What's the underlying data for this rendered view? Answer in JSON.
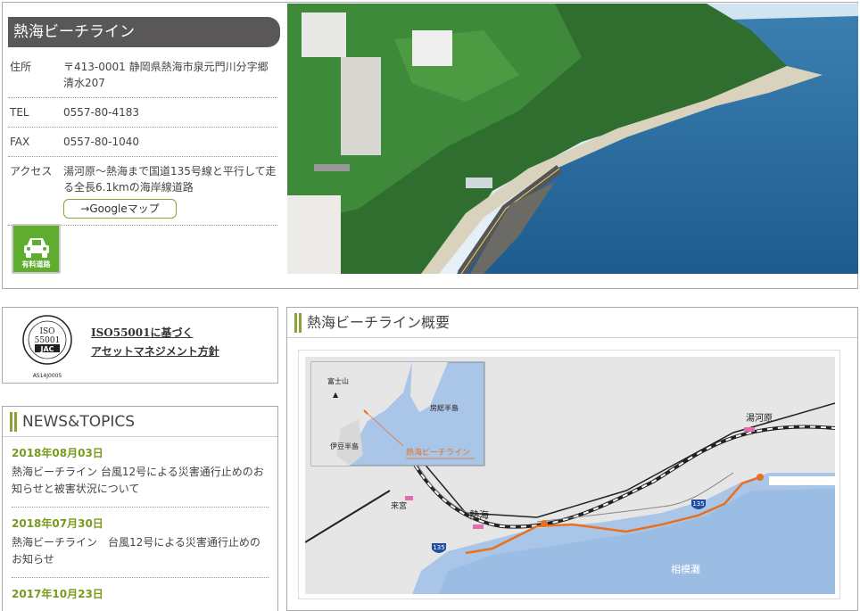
{
  "facility": {
    "title": "熱海ビーチライン",
    "rows": [
      {
        "label": "住所",
        "value": "〒413-0001 静岡県熱海市泉元門川分字郷清水207"
      },
      {
        "label": "TEL",
        "value": "0557-80-4183"
      },
      {
        "label": "FAX",
        "value": "0557-80-1040"
      },
      {
        "label": "アクセス",
        "value": "湯河原～熱海まで国道135号線と平行して走る全長6.1kmの海岸線道路"
      }
    ],
    "map_button": "→Googleマップ",
    "toll_badge": "有料道路"
  },
  "iso": {
    "logo_text_top": "ISO",
    "logo_text_num": "55001",
    "logo_text_jac": "JAC",
    "logo_code": "AS14J0005",
    "link_line1": "ISO55001に基づく",
    "link_line2": "アセットマネジメント方針"
  },
  "news": {
    "heading": "NEWS&TOPICS",
    "items": [
      {
        "date": "2018年08月03日",
        "text": "熱海ビーチライン 台風12号による災害通行止めのお知らせと被害状況について"
      },
      {
        "date": "2018年07月30日",
        "text": "熱海ビーチライン　台風12号による災害通行止めのお知らせ"
      },
      {
        "date": "2017年10月23日",
        "text": ""
      }
    ]
  },
  "overview": {
    "heading": "熱海ビーチライン概要",
    "map_labels": {
      "fuji": "富士山",
      "boso": "房総半島",
      "izu": "伊豆半島",
      "line": "熱海ビーチライン",
      "yugawara": "湯河原",
      "kinomiya": "来宮",
      "atami": "熱海",
      "sagami": "相模灘",
      "route1": "135",
      "route2": "135"
    }
  },
  "colors": {
    "title_bar": "#595757",
    "accent_green": "#8aa23a",
    "date_green": "#7a9a1e",
    "toll_green": "#5fad2f",
    "route_orange": "#e8701f",
    "sea": "#a9c6e8"
  }
}
